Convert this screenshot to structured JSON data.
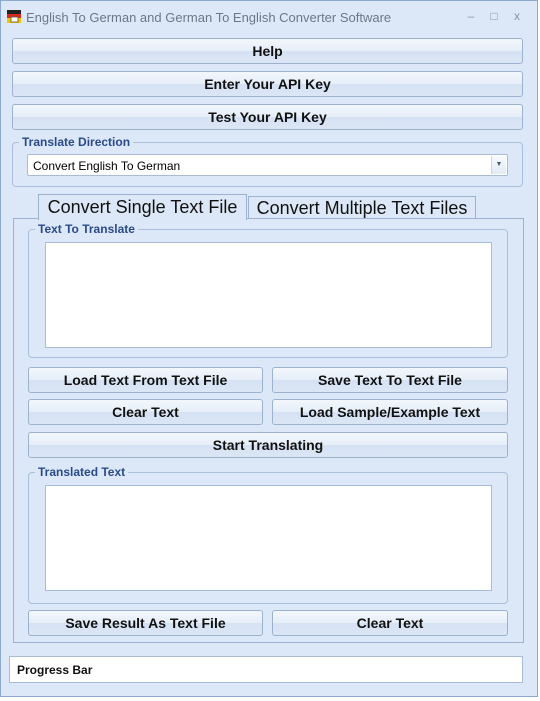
{
  "window": {
    "title": "English To German and German To English Converter Software",
    "minimize_glyph": "–",
    "maximize_glyph": "□",
    "close_glyph": "x"
  },
  "toolbar": {
    "help_label": "Help",
    "enter_api_key_label": "Enter Your API Key",
    "test_api_key_label": "Test Your API Key"
  },
  "translate_direction": {
    "group_title": "Translate Direction",
    "selected": "Convert English To German",
    "arrow_glyph": "▼"
  },
  "tabs": [
    {
      "label": "Convert Single Text File",
      "active": true
    },
    {
      "label": "Convert Multiple Text Files",
      "active": false
    }
  ],
  "input_section": {
    "group_title": "Text To Translate",
    "value": "",
    "load_button": "Load Text From Text File",
    "save_button": "Save Text To Text File",
    "clear_button": "Clear Text",
    "load_sample_button": "Load Sample/Example Text",
    "start_button": "Start Translating"
  },
  "output_section": {
    "group_title": "Translated Text",
    "value": "",
    "save_result_button": "Save Result As Text File",
    "clear_button": "Clear Text"
  },
  "status": {
    "progress_label": "Progress Bar"
  },
  "colors": {
    "window_bg": "#dce8f7",
    "group_title": "#2a4a8a",
    "border": "#9cb2cf"
  },
  "icons": {
    "app_icon": "flag-germany-icon",
    "combo_arrow": "chevron-down-icon"
  }
}
